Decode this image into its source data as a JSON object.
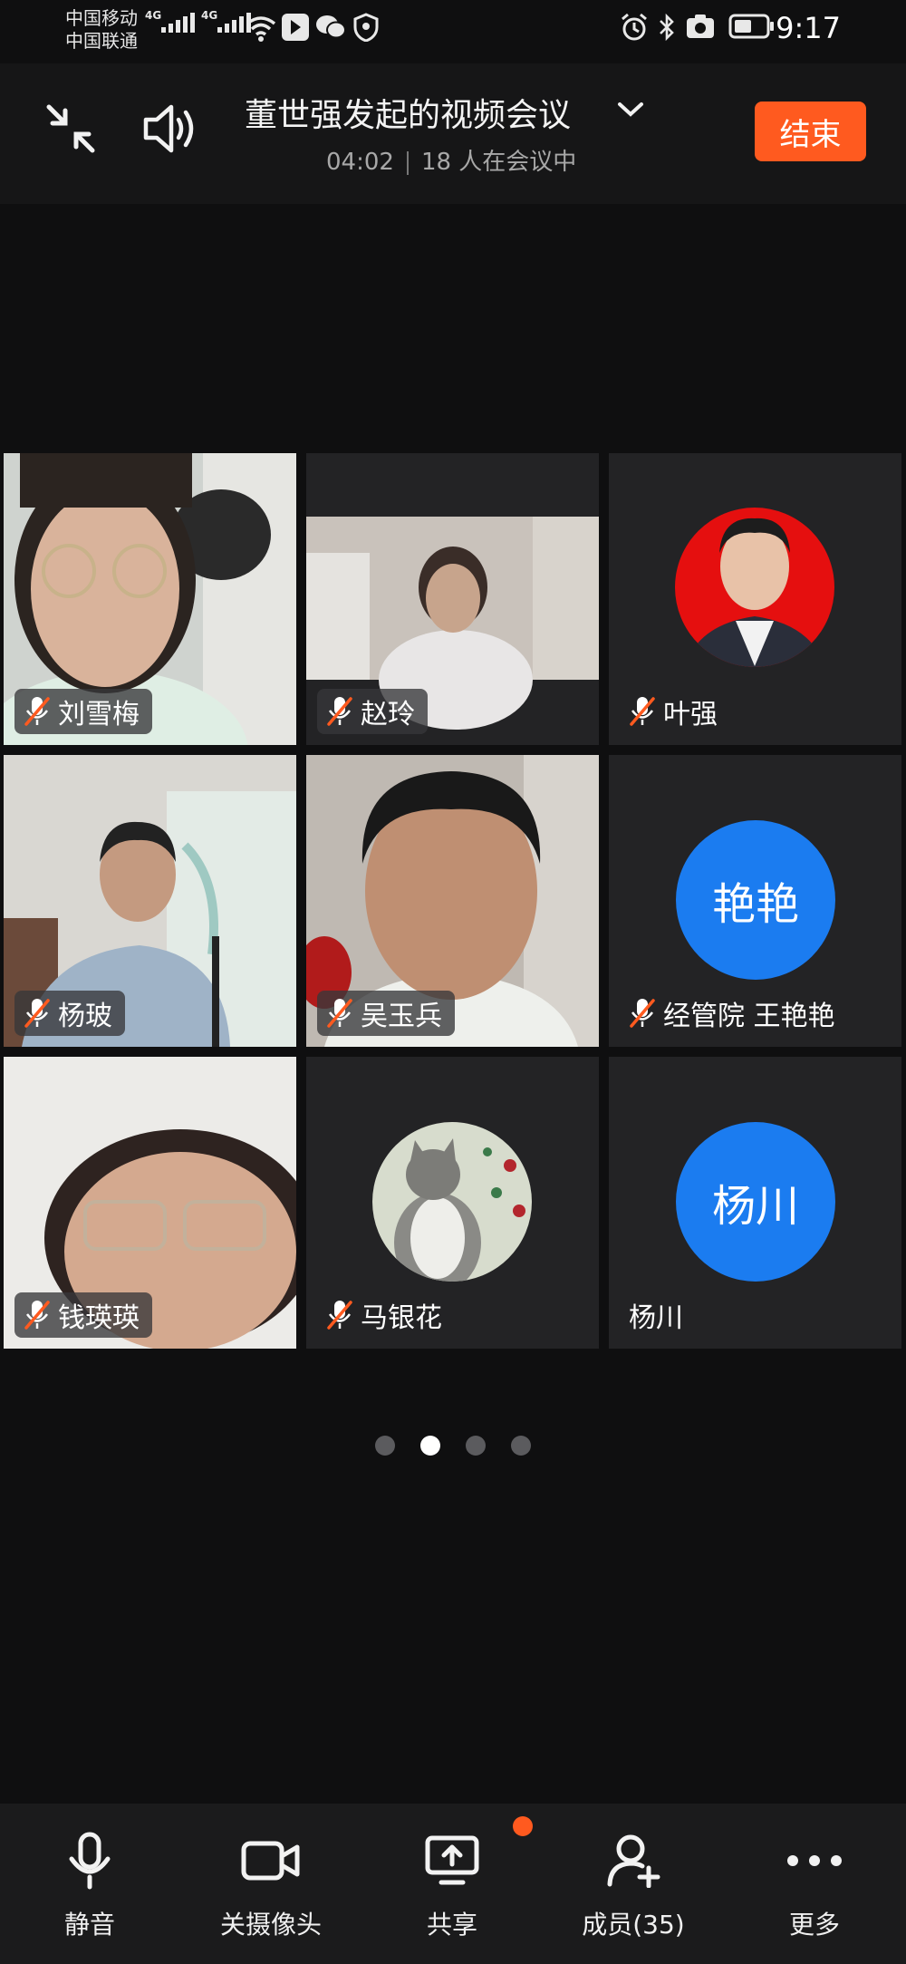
{
  "status_bar": {
    "carrier_1": "中国移动",
    "carrier_2": "中国联通",
    "network": "4G",
    "time": "9:17"
  },
  "header": {
    "title": "董世强发起的视频会议",
    "duration": "04:02",
    "participants_text": "18 人在会议中",
    "end_button": "结束"
  },
  "tiles": [
    {
      "name": "刘雪梅",
      "muted": true,
      "type": "video"
    },
    {
      "name": "赵玲",
      "muted": true,
      "type": "video"
    },
    {
      "name": "叶强",
      "muted": true,
      "type": "photo"
    },
    {
      "name": "杨玻",
      "muted": true,
      "type": "video"
    },
    {
      "name": "吴玉兵",
      "muted": true,
      "type": "video"
    },
    {
      "name": "经管院 王艳艳",
      "muted": true,
      "type": "avatar",
      "avatar_text": "艳艳"
    },
    {
      "name": "钱瑛瑛",
      "muted": true,
      "type": "video"
    },
    {
      "name": "马银花",
      "muted": true,
      "type": "photo"
    },
    {
      "name": "杨川",
      "muted": false,
      "type": "avatar",
      "avatar_text": "杨川"
    }
  ],
  "pager": {
    "count": 4,
    "active_index": 1
  },
  "toolbar": {
    "mute": "静音",
    "camera": "关摄像头",
    "share": "共享",
    "members": "成员(35)",
    "more": "更多"
  },
  "colors": {
    "accent": "#ff5a1f",
    "avatar_blue": "#1b7cf0",
    "background": "#0f0f10"
  },
  "icons": [
    "collapse-icon",
    "speaker-icon",
    "chevron-down-icon",
    "mic-muted-icon",
    "microphone-icon",
    "camera-icon",
    "share-screen-icon",
    "add-member-icon",
    "more-icon"
  ]
}
